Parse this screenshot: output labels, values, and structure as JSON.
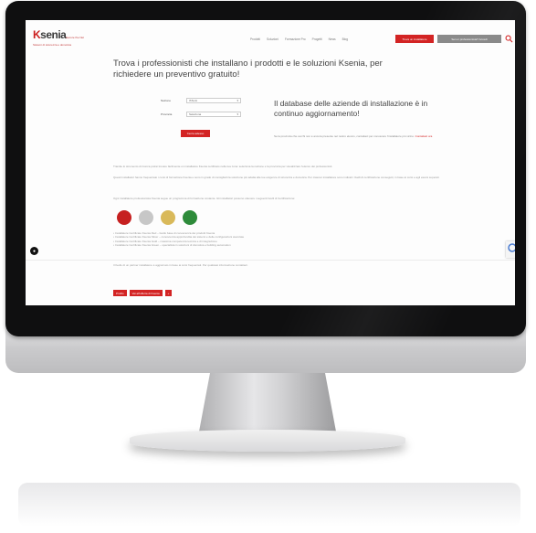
{
  "header": {
    "logo_text_k": "K",
    "logo_text_rest": "senia",
    "logo_subtitle": "Secure the Net",
    "logo_tagline": "Sistemi di sicurezza e domotica",
    "nav": [
      "Prodotti",
      "Soluzioni",
      "Formazione Pro",
      "Progetti",
      "News",
      "Blog"
    ],
    "cta_primary": "Trova un installatore",
    "cta_secondary": "Sei un professionista? Accedi",
    "search_icon": "search-icon"
  },
  "hero": {
    "title": "Trova i professionisti che installano i prodotti e le soluzioni Ksenia, per richiedere un preventivo gratuito!"
  },
  "form": {
    "nation_label": "Nazione",
    "nation_value": "ITALIA",
    "province_label": "Provincia",
    "province_value": "Seleziona",
    "search_button": "Cerca adesso"
  },
  "database": {
    "title": "Il database delle aziende di installazione è in continuo aggiornamento!",
    "note": "Se la provincia che cerchi non è ancora presente nel nostro elenco, contattaci per conoscere l'installatore più vicino. ",
    "note_link": "Contattaci ora"
  },
  "content": {
    "para1": "Tramite lo strumento di ricerca potrai trovare facilmente un installatore Ksenia certificato nella tua zona: seleziona la nazione e la provincia per visualizzare l'elenco dei professionisti.",
    "para2": "Questi installatori hanno frequentato i corsi di formazione Ksenia e sono in grado di consigliarti la soluzione più adatta alle tue esigenze di sicurezza e domotica. Per ciascun installatore sono indicati i livelli di certificazione conseguiti, in base ai corsi e agli esami superati.",
    "para3": "Ogni installatore professionista Ksenia segue un programma di formazione costante. Gli installatori possono ottenere i seguenti livelli di Certificazione:",
    "list": [
      "• Installatore Certificato Ksenia Red – livello base di conoscenza dei prodotti Ksenia",
      "• Installatore Certificato Ksenia Silver – conoscenza approfondita dei sistemi e delle configurazioni avanzate",
      "• Installatore Certificato Ksenia Gold – massima competenza tecnica e di integrazione",
      "• Installatore Certificato Ksenia Green – specialista in soluzioni di domotica e building automation"
    ],
    "footnote": "Il livello di un partner installatore è aggiornato in base ai corsi frequentati. Per qualsiasi informazione contattaci.",
    "bottom_buttons": [
      "Profilo",
      "Vai all'offerta di Ksenia",
      "+"
    ]
  },
  "colors": {
    "brand_red": "#d32424",
    "cert_red": "#c62020",
    "cert_silver": "#c7c7c7",
    "cert_gold": "#d9b95a",
    "cert_green": "#2e8b3a"
  }
}
